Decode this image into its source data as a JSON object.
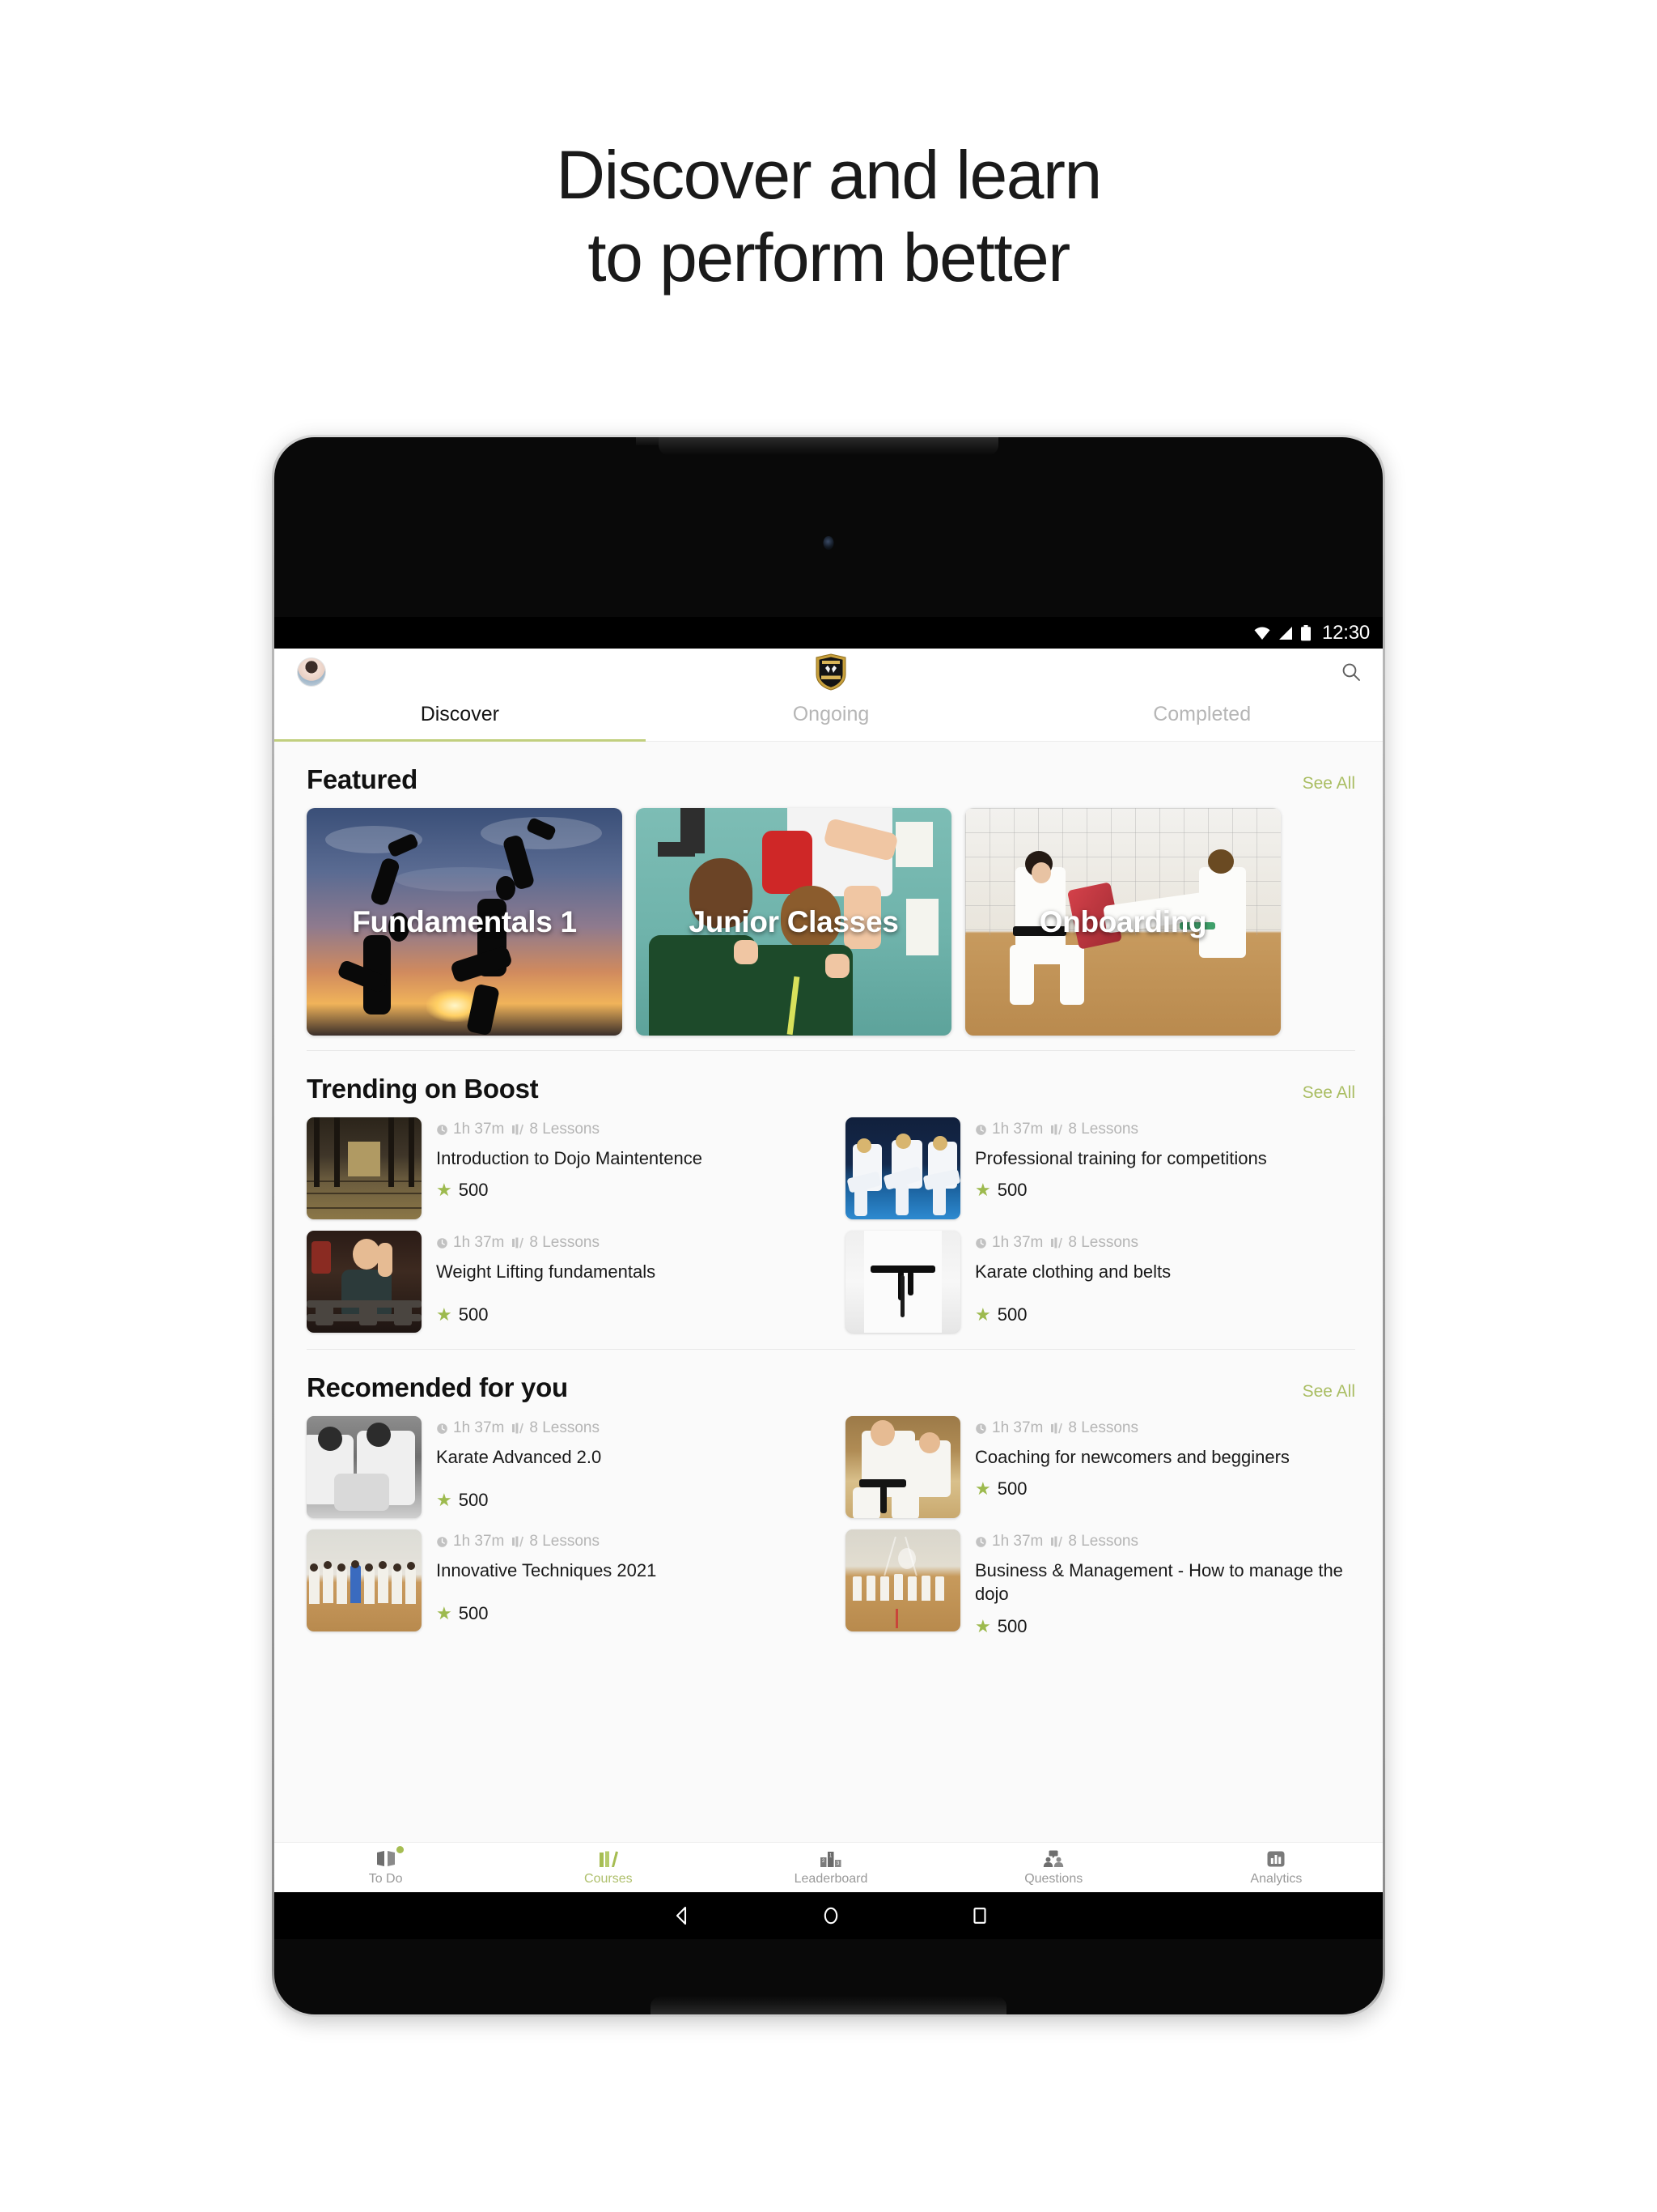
{
  "marketing": {
    "line1": "Discover and learn",
    "line2": "to perform better"
  },
  "status_bar": {
    "time": "12:30",
    "icons": [
      "wifi-icon",
      "signal-icon",
      "battery-icon"
    ]
  },
  "app_bar": {
    "avatar": "user-avatar",
    "logo": "dojo-shield-logo",
    "search": "search-icon"
  },
  "tabs": [
    {
      "label": "Discover",
      "active": true
    },
    {
      "label": "Ongoing",
      "active": false
    },
    {
      "label": "Completed",
      "active": false
    }
  ],
  "see_all_label": "See All",
  "sections": {
    "featured": {
      "title": "Featured",
      "see_all": "See All",
      "cards": [
        {
          "caption": "Fundamentals 1"
        },
        {
          "caption": "Junior Classes"
        },
        {
          "caption": "Onboarding"
        }
      ]
    },
    "trending": {
      "title": "Trending on Boost",
      "see_all": "See All",
      "courses": [
        {
          "duration": "1h 37m",
          "lessons": "8 Lessons",
          "name": "Introduction to Dojo Maintentence",
          "points": "500"
        },
        {
          "duration": "1h 37m",
          "lessons": "8 Lessons",
          "name": "Professional training for competitions",
          "points": "500"
        },
        {
          "duration": "1h 37m",
          "lessons": "8 Lessons",
          "name": "Weight Lifting fundamentals",
          "points": "500"
        },
        {
          "duration": "1h 37m",
          "lessons": "8 Lessons",
          "name": "Karate clothing and belts",
          "points": "500"
        }
      ]
    },
    "recommended": {
      "title": "Recomended for you",
      "see_all": "See All",
      "courses": [
        {
          "duration": "1h 37m",
          "lessons": "8 Lessons",
          "name": "Karate Advanced 2.0",
          "points": "500"
        },
        {
          "duration": "1h 37m",
          "lessons": "8 Lessons",
          "name": "Coaching for newcomers and begginers",
          "points": "500"
        },
        {
          "duration": "1h 37m",
          "lessons": "8 Lessons",
          "name": "Innovative Techniques 2021",
          "points": "500"
        },
        {
          "duration": "1h 37m",
          "lessons": "8 Lessons",
          "name": "Business & Management - How to manage the dojo",
          "points": "500"
        }
      ]
    }
  },
  "bottom_nav": [
    {
      "label": "To Do",
      "icon": "open-book-icon",
      "active": false,
      "badge": true
    },
    {
      "label": "Courses",
      "icon": "books-icon",
      "active": true,
      "badge": false
    },
    {
      "label": "Leaderboard",
      "icon": "podium-icon",
      "active": false,
      "badge": false
    },
    {
      "label": "Questions",
      "icon": "people-chat-icon",
      "active": false,
      "badge": false
    },
    {
      "label": "Analytics",
      "icon": "bar-chart-icon",
      "active": false,
      "badge": false
    }
  ],
  "system_bar": {
    "back": "back-triangle-icon",
    "home": "home-circle-icon",
    "recents": "recents-square-icon"
  },
  "colors": {
    "accent_green": "#a9bd62",
    "tab_indicator": "#c1cf7e",
    "star_green": "#9dba4e",
    "text_primary": "#111111",
    "text_muted": "#b5b5b5"
  }
}
